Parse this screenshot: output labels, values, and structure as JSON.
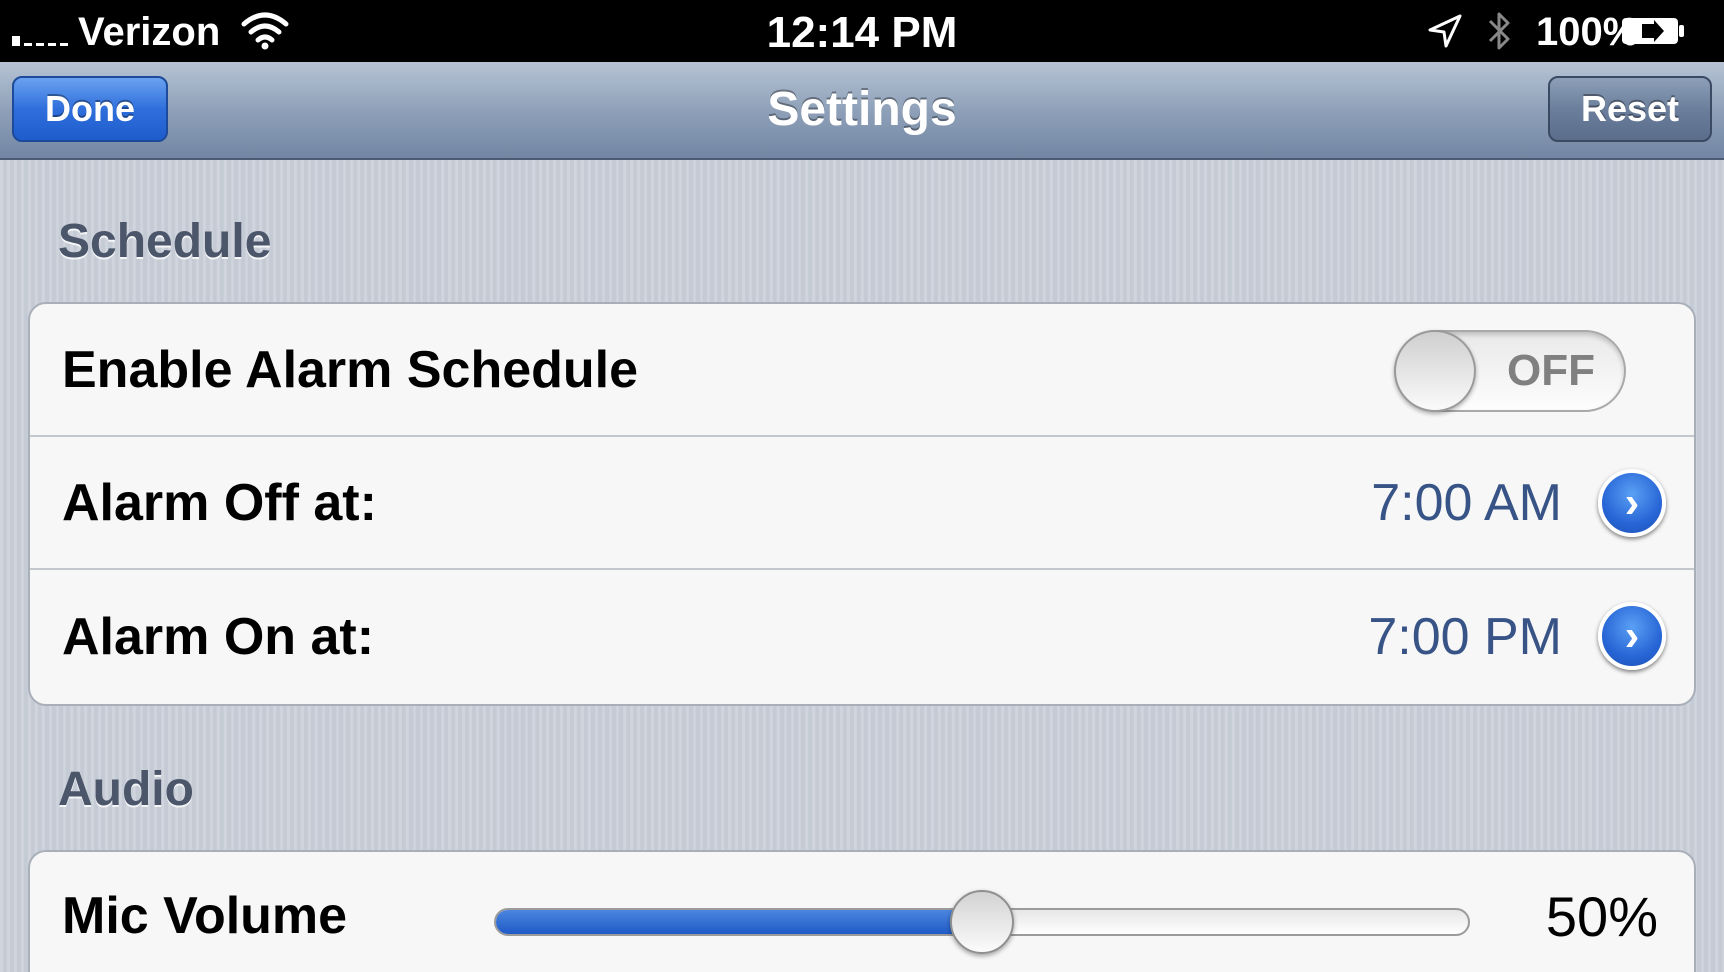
{
  "status_bar": {
    "carrier": "Verizon",
    "time": "12:14 PM",
    "battery": "100%",
    "icons": [
      "signal-icon",
      "wifi-icon",
      "location-arrow-icon",
      "bluetooth-icon",
      "battery-charging-icon"
    ]
  },
  "nav": {
    "title": "Settings",
    "done_label": "Done",
    "reset_label": "Reset"
  },
  "sections": {
    "schedule": {
      "header": "Schedule",
      "enable_label": "Enable Alarm Schedule",
      "enable_state": "OFF",
      "alarm_off_label": "Alarm Off at:",
      "alarm_off_value": "7:00 AM",
      "alarm_on_label": "Alarm On at:",
      "alarm_on_value": "7:00 PM"
    },
    "audio": {
      "header": "Audio",
      "mic_label": "Mic Volume",
      "mic_value_text": "50%",
      "mic_value_fraction": 0.5
    }
  },
  "colors": {
    "accent_blue": "#2866d6",
    "value_text": "#385487",
    "section_header": "#4c566a"
  }
}
